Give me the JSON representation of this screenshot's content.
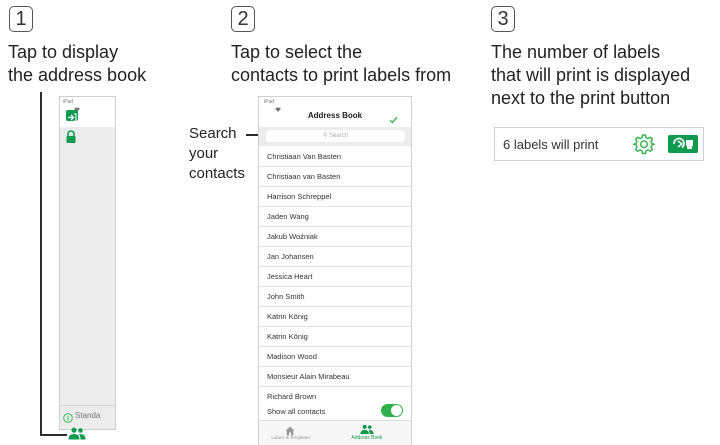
{
  "steps": [
    {
      "number": "1",
      "title_lines": [
        "Tap to display",
        "the address book"
      ]
    },
    {
      "number": "2",
      "title_lines": [
        "Tap to select the",
        "contacts to print labels from"
      ]
    },
    {
      "number": "3",
      "title_lines": [
        "The number of labels",
        "that will print is displayed",
        "next to the print button"
      ]
    }
  ],
  "ipad_strip": {
    "status": "iPad",
    "footer_text": "Standa"
  },
  "search_callout": [
    "Search",
    "your",
    "contacts"
  ],
  "phone": {
    "status": "iPad",
    "nav_title": "Address Book",
    "search_placeholder": "Search",
    "contacts": [
      "Christiaan Van Basten",
      "Christiaan van Basten",
      "Harrison Schreppel",
      "Jaden Wang",
      "Jakub Woźniak",
      "Jan Johansen",
      "Jessica Heart",
      "John Smith",
      "Katrin König",
      "Katrin König",
      "Madison Wood",
      "Monsieur Alain Mirabeau",
      "Richard Brown"
    ],
    "show_all_label": "Show all contacts",
    "show_all_on": true,
    "tabs": [
      {
        "label": "Labels & Templates",
        "icon": "home-icon",
        "active": false
      },
      {
        "label": "Address Book",
        "icon": "people-icon",
        "active": true
      }
    ]
  },
  "print_bar": {
    "status_text": "6 labels will print"
  },
  "colors": {
    "accent_green": "#2fb14b",
    "dark_green": "#0e9a4f",
    "line": "#2c2c2c"
  }
}
